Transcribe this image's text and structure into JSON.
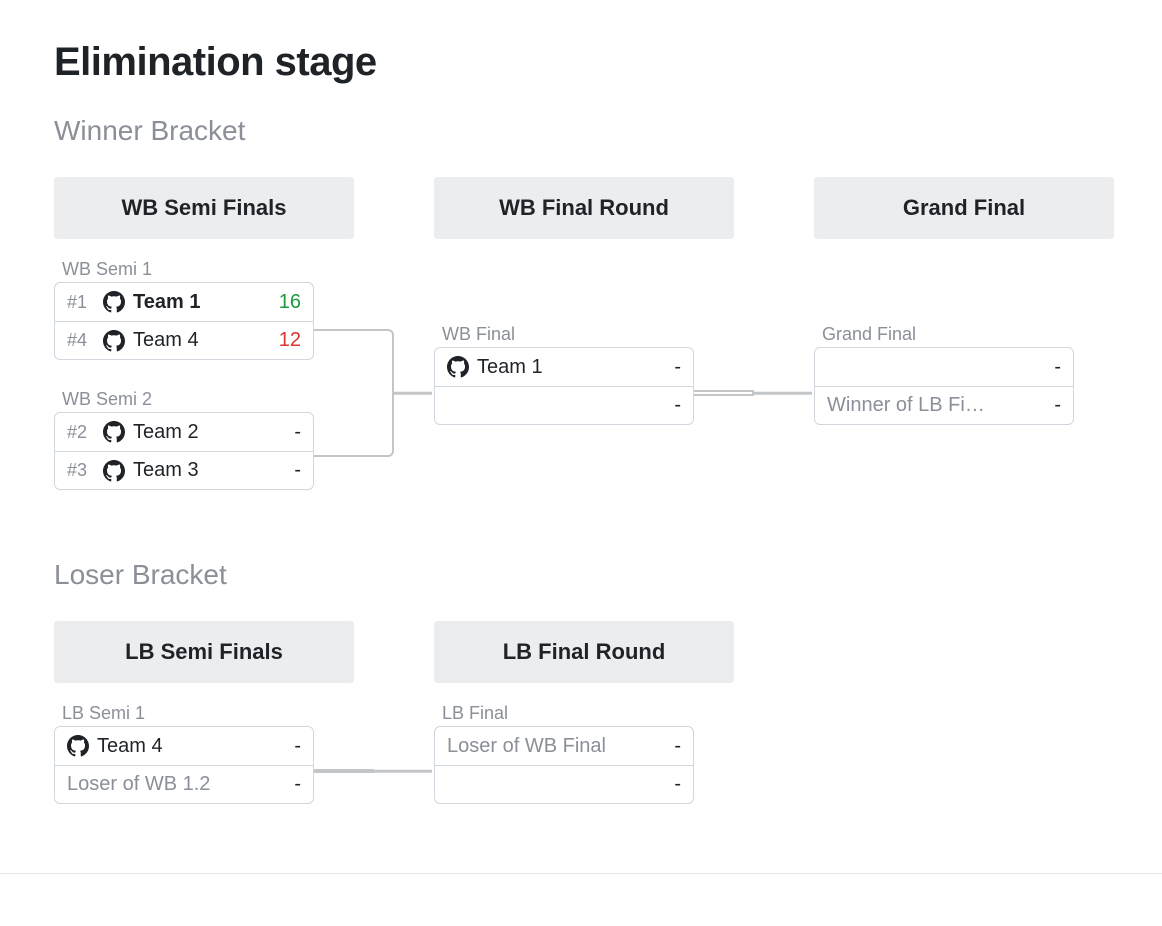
{
  "title": "Elimination stage",
  "winner_bracket": {
    "label": "Winner Bracket",
    "rounds": [
      "WB Semi Finals",
      "WB Final Round",
      "Grand Final"
    ],
    "matches": {
      "semi1": {
        "caption": "WB Semi 1",
        "row1": {
          "seed": "#1",
          "team": "Team 1",
          "score": "16",
          "winning": true,
          "placeholder": false,
          "icon": true
        },
        "row2": {
          "seed": "#4",
          "team": "Team 4",
          "score": "12",
          "winning": false,
          "placeholder": false,
          "icon": true
        }
      },
      "semi2": {
        "caption": "WB Semi 2",
        "row1": {
          "seed": "#2",
          "team": "Team 2",
          "score": "-",
          "winning": false,
          "placeholder": false,
          "icon": true
        },
        "row2": {
          "seed": "#3",
          "team": "Team 3",
          "score": "-",
          "winning": false,
          "placeholder": false,
          "icon": true
        }
      },
      "final": {
        "caption": "WB Final",
        "row1": {
          "seed": "",
          "team": "Team 1",
          "score": "-",
          "winning": false,
          "placeholder": false,
          "icon": true
        },
        "row2": {
          "seed": "",
          "team": "",
          "score": "-",
          "winning": false,
          "placeholder": true,
          "icon": false
        }
      },
      "grand": {
        "caption": "Grand Final",
        "row1": {
          "seed": "",
          "team": "",
          "score": "-",
          "winning": false,
          "placeholder": true,
          "icon": false
        },
        "row2": {
          "seed": "",
          "team": "Winner of LB Fi…",
          "score": "-",
          "winning": false,
          "placeholder": true,
          "icon": false
        }
      }
    }
  },
  "loser_bracket": {
    "label": "Loser Bracket",
    "rounds": [
      "LB Semi Finals",
      "LB Final Round"
    ],
    "matches": {
      "semi1": {
        "caption": "LB Semi 1",
        "row1": {
          "seed": "",
          "team": "Team 4",
          "score": "-",
          "winning": false,
          "placeholder": false,
          "icon": true
        },
        "row2": {
          "seed": "",
          "team": "Loser of WB 1.2",
          "score": "-",
          "winning": false,
          "placeholder": true,
          "icon": false
        }
      },
      "final": {
        "caption": "LB Final",
        "row1": {
          "seed": "",
          "team": "Loser of WB Final",
          "score": "-",
          "winning": false,
          "placeholder": true,
          "icon": false
        },
        "row2": {
          "seed": "",
          "team": "",
          "score": "-",
          "winning": false,
          "placeholder": true,
          "icon": false
        }
      }
    }
  }
}
